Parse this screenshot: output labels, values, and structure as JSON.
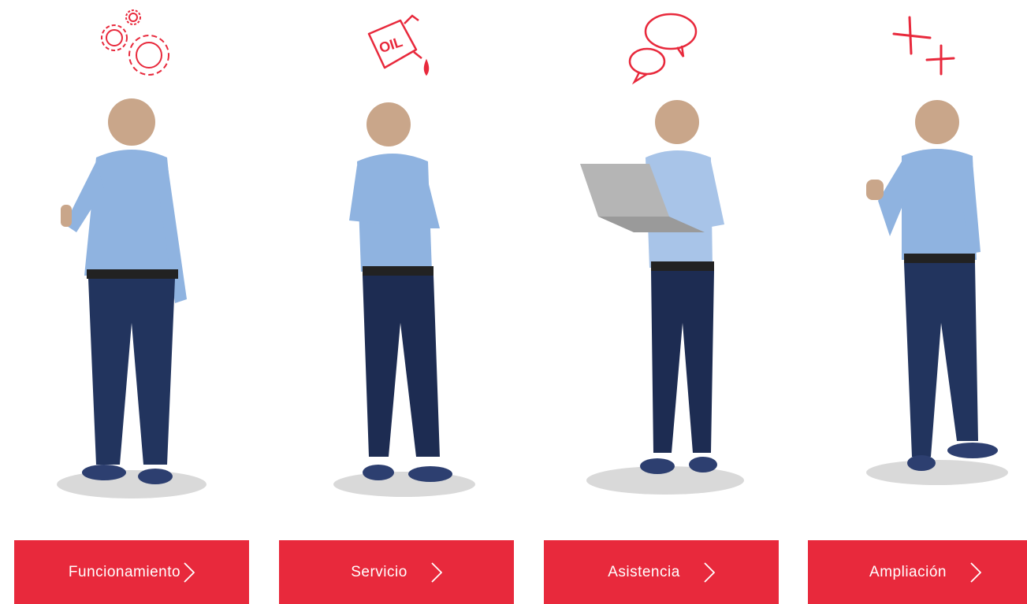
{
  "accent_color": "#e8293c",
  "cards": [
    {
      "icon": "gears-icon",
      "label": "Funcionamiento"
    },
    {
      "icon": "oil-can-icon",
      "label": "Servicio"
    },
    {
      "icon": "chat-bubbles-icon",
      "label": "Asistencia"
    },
    {
      "icon": "plus-plus-icon",
      "label": "Ampliación"
    }
  ]
}
